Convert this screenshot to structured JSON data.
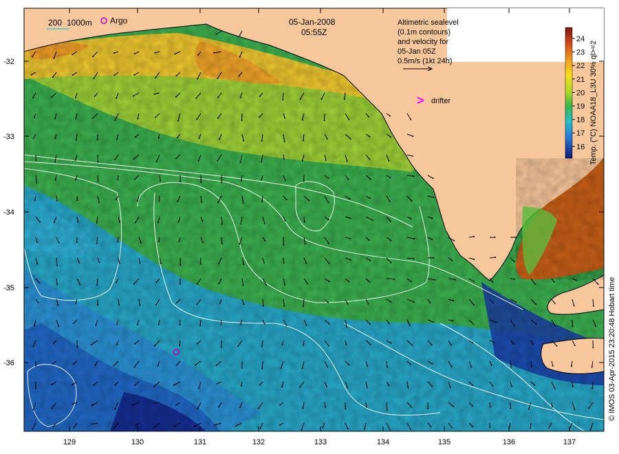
{
  "title": {
    "date": "05-Jan-2008",
    "time": "05:55Z"
  },
  "scale_legend": {
    "label_200": "200",
    "label_1000": "1000m",
    "argo_label": "Argo"
  },
  "altimetry_note": {
    "line1": "Altimetric sealevel",
    "line2": "(0.1m contours)",
    "line3": "and velocity for",
    "line4": "05-Jan 05Z",
    "line5": "0.5m/s (1kt 24h)"
  },
  "drifter_legend": {
    "glyph": ">",
    "label": "drifter"
  },
  "colorbar": {
    "ticks": [
      "24",
      "23",
      "22",
      "21",
      "20",
      "19",
      "18",
      "17",
      "16"
    ],
    "title": "Temp. (°C) NOAA18_L3U 30% ql>=2"
  },
  "axes": {
    "x_ticks": [
      "129",
      "130",
      "131",
      "132",
      "133",
      "134",
      "135",
      "136",
      "137"
    ],
    "y_ticks": [
      "-32",
      "-33",
      "-34",
      "-35",
      "-36"
    ]
  },
  "credit": "© IMOS 03-Apr-2015 23:20:48 Hobart time",
  "colors": {
    "land": "#f8c89c",
    "sst_warm": "#e07a18",
    "sst_mid": "#4ec04a",
    "sst_cool": "#27a8d6",
    "sst_cold": "#1838b0",
    "contour": "#ffffff",
    "argo_marker": "#c000c0",
    "drifter_marker": "#ff00ff"
  }
}
